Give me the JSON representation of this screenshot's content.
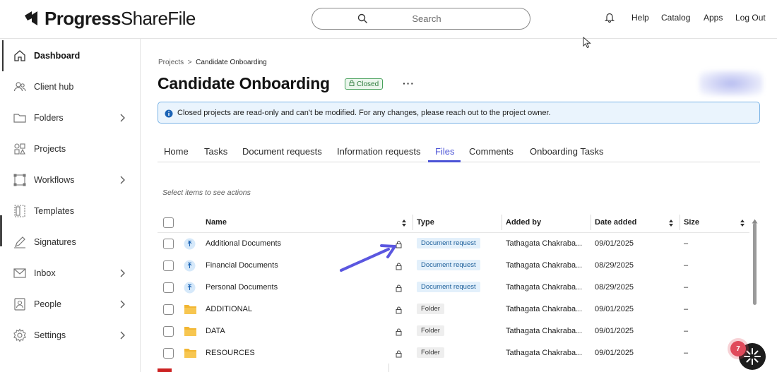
{
  "app": {
    "logo_text_bold": "Progress",
    "logo_text_thin": "ShareFile"
  },
  "header": {
    "search_placeholder": "Search",
    "links": [
      "Help",
      "Catalog",
      "Apps",
      "Log Out"
    ]
  },
  "sidebar": {
    "items": [
      {
        "label": "Dashboard",
        "icon": "home-icon",
        "active": true,
        "has_chevron": false
      },
      {
        "label": "Client hub",
        "icon": "people-group-icon",
        "active": false,
        "has_chevron": false
      },
      {
        "label": "Folders",
        "icon": "folder-icon",
        "active": false,
        "has_chevron": true
      },
      {
        "label": "Projects",
        "icon": "shapes-icon",
        "active": false,
        "has_chevron": false
      },
      {
        "label": "Workflows",
        "icon": "workflow-icon",
        "active": false,
        "has_chevron": true
      },
      {
        "label": "Templates",
        "icon": "template-icon",
        "active": false,
        "has_chevron": false
      },
      {
        "label": "Signatures",
        "icon": "pen-icon",
        "active": false,
        "has_chevron": false
      },
      {
        "label": "Inbox",
        "icon": "mail-icon",
        "active": false,
        "has_chevron": true
      },
      {
        "label": "People",
        "icon": "person-badge-icon",
        "active": false,
        "has_chevron": true
      },
      {
        "label": "Settings",
        "icon": "gear-icon",
        "active": false,
        "has_chevron": true
      }
    ]
  },
  "breadcrumb": {
    "parent": "Projects",
    "separator": ">",
    "current": "Candidate Onboarding"
  },
  "page": {
    "title": "Candidate Onboarding",
    "status_badge": "Closed",
    "more_label": "···"
  },
  "banner": {
    "text": "Closed projects are read-only and can't be modified. For any changes, please reach out to the project owner."
  },
  "tabs": [
    {
      "label": "Home",
      "active": false
    },
    {
      "label": "Tasks",
      "active": false
    },
    {
      "label": "Document requests",
      "active": false
    },
    {
      "label": "Information requests",
      "active": false
    },
    {
      "label": "Files",
      "active": true
    },
    {
      "label": "Comments",
      "active": false
    },
    {
      "label": "Onboarding Tasks",
      "active": false
    }
  ],
  "table": {
    "hint": "Select items to see actions",
    "columns": [
      "Name",
      "Type",
      "Added by",
      "Date added",
      "Size"
    ],
    "rows": [
      {
        "name": "Additional Documents",
        "kind": "request",
        "type": "Document request",
        "added_by": "Tathagata Chakraba...",
        "date": "09/01/2025",
        "size": "–"
      },
      {
        "name": "Financial Documents",
        "kind": "request",
        "type": "Document request",
        "added_by": "Tathagata Chakraba...",
        "date": "08/29/2025",
        "size": "–"
      },
      {
        "name": "Personal Documents",
        "kind": "request",
        "type": "Document request",
        "added_by": "Tathagata Chakraba...",
        "date": "08/29/2025",
        "size": "–"
      },
      {
        "name": "ADDITIONAL",
        "kind": "folder",
        "type": "Folder",
        "added_by": "Tathagata Chakraba...",
        "date": "09/01/2025",
        "size": "–"
      },
      {
        "name": "DATA",
        "kind": "folder",
        "type": "Folder",
        "added_by": "Tathagata Chakraba...",
        "date": "09/01/2025",
        "size": "–"
      },
      {
        "name": "RESOURCES",
        "kind": "folder",
        "type": "Folder",
        "added_by": "Tathagata Chakraba...",
        "date": "09/01/2025",
        "size": "–"
      }
    ]
  },
  "assistant": {
    "badge_count": "7"
  },
  "colors": {
    "accent": "#4b53d6",
    "closed_badge": "#2f7d3e",
    "banner_bg": "#eaf4fd",
    "folder": "#f2b632",
    "request_icon_bg": "#d6e9fa",
    "annotation_arrow": "#5b57e0",
    "notify_badge": "#e04a5b"
  }
}
